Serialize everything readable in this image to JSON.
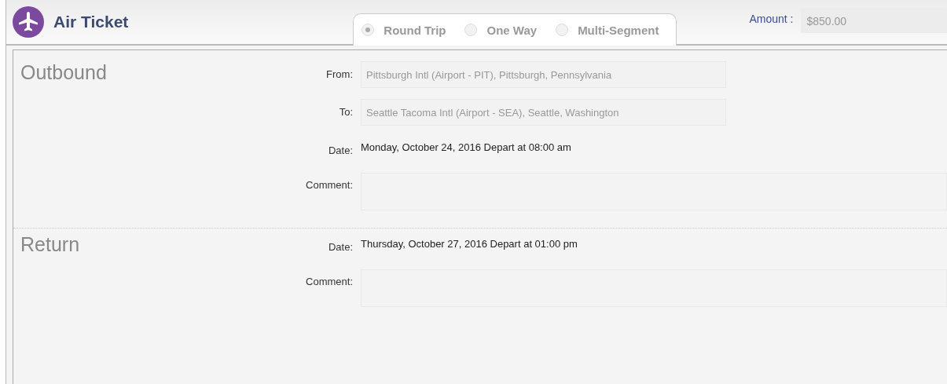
{
  "header": {
    "title": "Air Ticket"
  },
  "trip_types": [
    {
      "label": "Round Trip",
      "selected": true
    },
    {
      "label": "One Way",
      "selected": false
    },
    {
      "label": "Multi-Segment",
      "selected": false
    }
  ],
  "amount": {
    "label": "Amount :",
    "value": "$850.00"
  },
  "sections": [
    {
      "title": "Outbound",
      "fields": [
        {
          "kind": "input",
          "label": "From:",
          "value": "Pittsburgh Intl (Airport - PIT), Pittsburgh, Pennsylvania"
        },
        {
          "kind": "input",
          "label": "To:",
          "value": "Seattle Tacoma Intl (Airport - SEA), Seattle, Washington"
        },
        {
          "kind": "text",
          "label": "Date:",
          "value": "Monday, October 24, 2016 Depart at 08:00 am"
        },
        {
          "kind": "textarea",
          "label": "Comment:"
        }
      ]
    },
    {
      "title": "Return",
      "fields": [
        {
          "kind": "text",
          "label": "Date:",
          "value": "Thursday, October 27, 2016 Depart at 01:00 pm"
        },
        {
          "kind": "textarea",
          "label": "Comment:"
        }
      ]
    }
  ]
}
